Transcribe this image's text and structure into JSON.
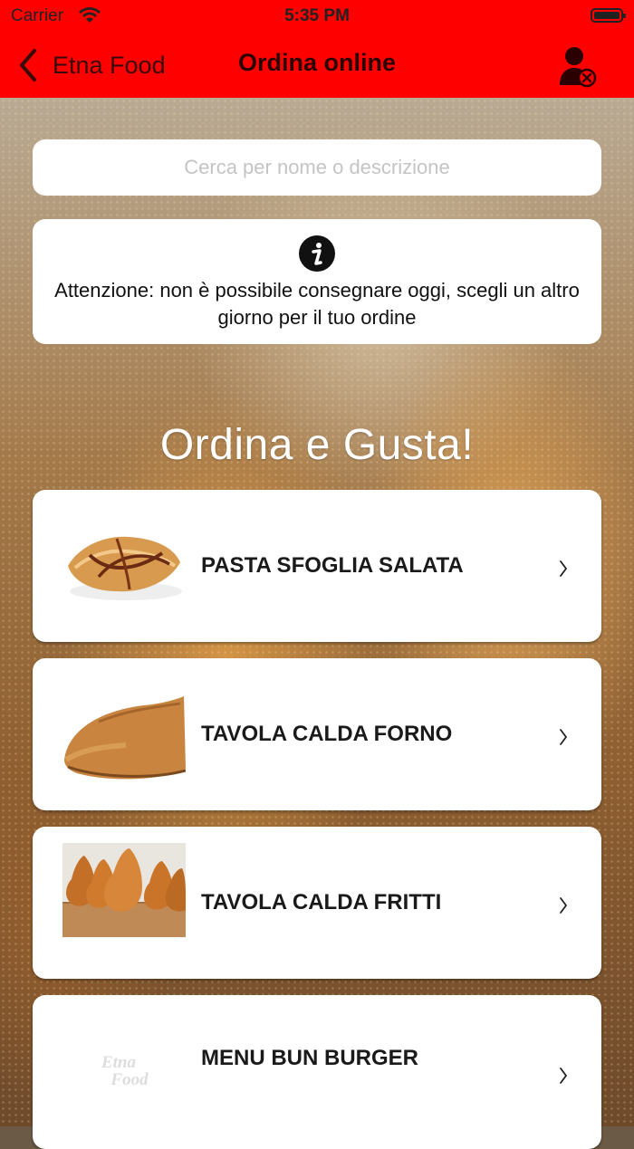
{
  "status_bar": {
    "carrier": "Carrier",
    "time": "5:35 PM"
  },
  "nav": {
    "back_label": "Etna Food",
    "title": "Ordina online"
  },
  "search": {
    "placeholder": "Cerca per nome o descrizione",
    "value": ""
  },
  "notice": {
    "icon": "info-icon",
    "message": "Attenzione: non è possibile consegnare oggi, scegli un altro giorno per il tuo ordine"
  },
  "heading": "Ordina e Gusta!",
  "categories": [
    {
      "name": "PASTA SFOGLIA SALATA",
      "icon": "pastry-image"
    },
    {
      "name": "TAVOLA CALDA FORNO",
      "icon": "calzone-image"
    },
    {
      "name": "TAVOLA CALDA FRITTI",
      "icon": "arancini-image"
    },
    {
      "name": "MENU BUN BURGER",
      "icon": "etna-food-logo"
    }
  ],
  "logo_text": {
    "line1": "Etna",
    "line2": "Food"
  },
  "colors": {
    "nav_bar": "#ff0000",
    "card": "#ffffff"
  }
}
